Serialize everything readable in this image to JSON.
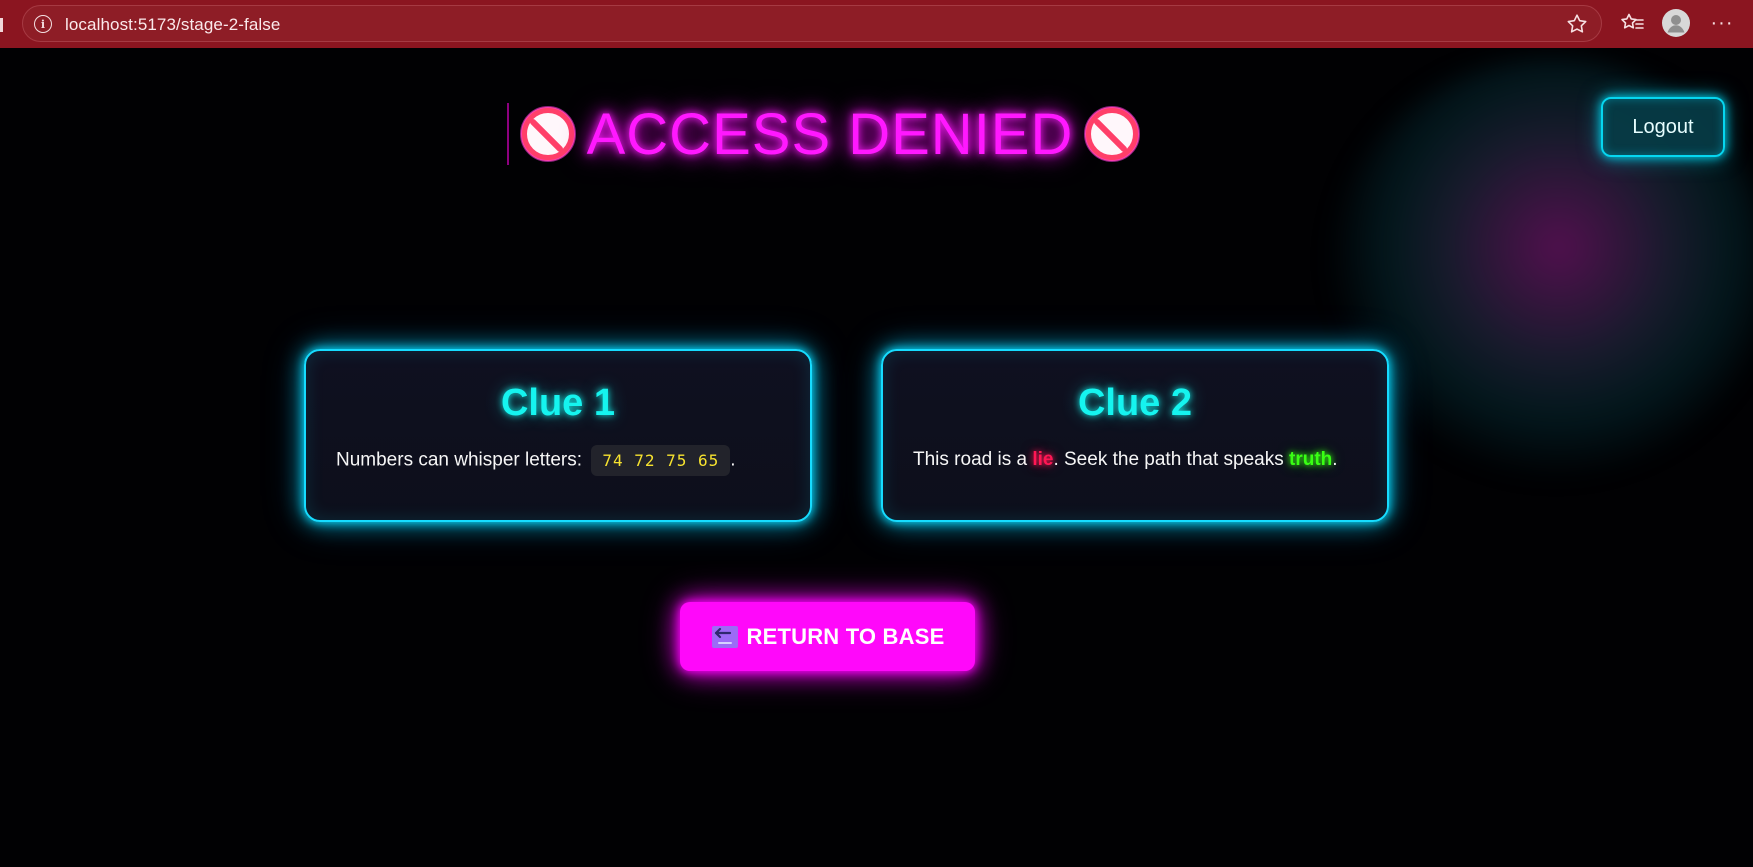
{
  "browser": {
    "url": "localhost:5173/stage-2-false",
    "icons": [
      "info-icon",
      "star-icon",
      "favorites-icon",
      "profile-icon",
      "more-icon"
    ],
    "more_label": "···"
  },
  "header": {
    "title": "ACCESS DENIED",
    "title_icon": "prohibited-icon",
    "logout_label": "Logout"
  },
  "clues": [
    {
      "title": "Clue 1",
      "text_prefix": "Numbers can whisper letters:",
      "code": "74 72 75 65",
      "text_suffix": "."
    },
    {
      "title": "Clue 2",
      "text_prefix": "This road is a",
      "lie_word": "lie",
      "text_middle": ". Seek the path that speaks",
      "truth_word": "truth",
      "text_suffix": "."
    }
  ],
  "action": {
    "return_label": "RETURN TO BASE",
    "return_icon": "back-arrow-icon"
  },
  "colors": {
    "browser_bar": "#8b1520",
    "title_magenta": "#ff18ff",
    "card_border_cyan": "#16dcff",
    "clue_title_cyan": "#15f4ef",
    "code_yellow": "#f6e22f",
    "lie_red": "#ff1754",
    "truth_green": "#39ff14",
    "button_magenta": "#ff08fa"
  }
}
